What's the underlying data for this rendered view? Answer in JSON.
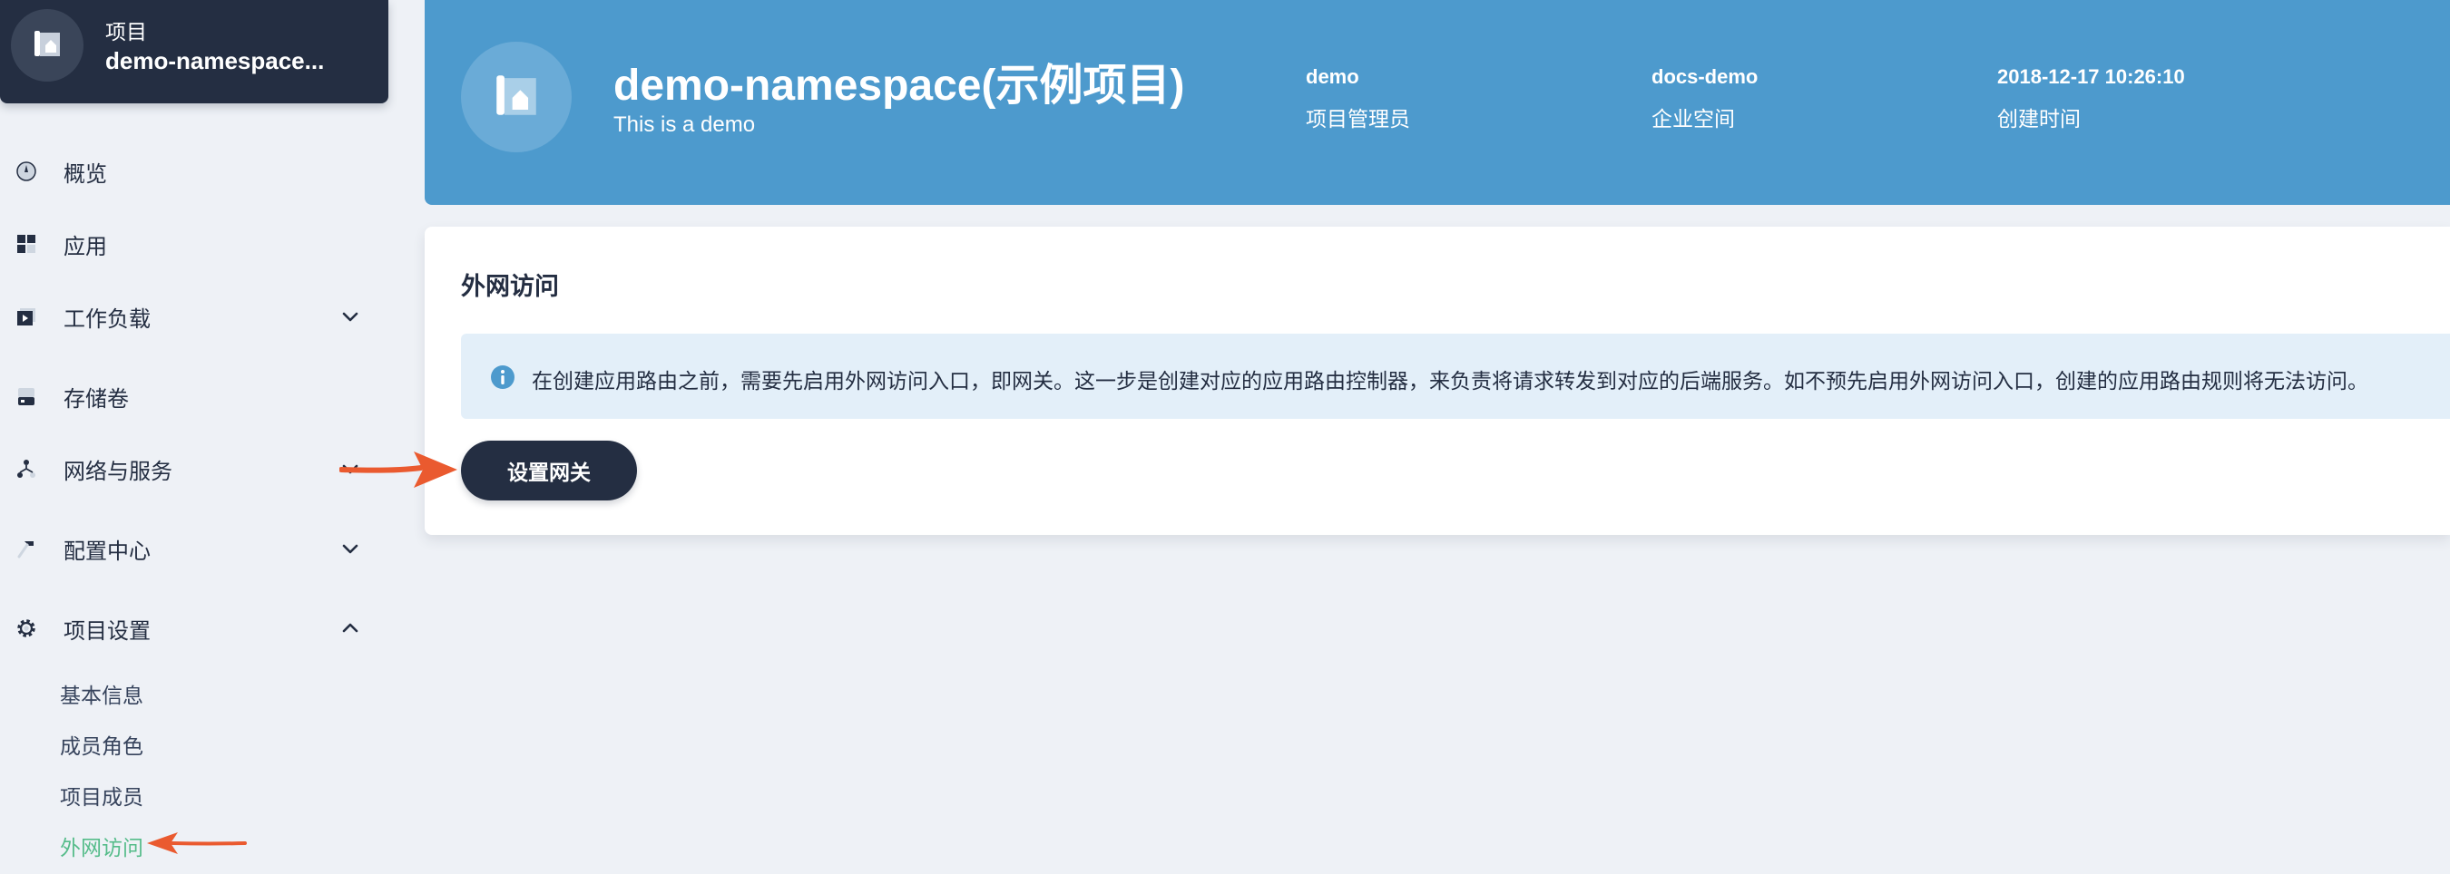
{
  "project_card": {
    "caption": "项目",
    "name": "demo-namespace..."
  },
  "sidebar": {
    "items": [
      {
        "label": "概览",
        "icon": "dashboard-icon"
      },
      {
        "label": "应用",
        "icon": "apps-icon"
      },
      {
        "label": "工作负载",
        "icon": "workload-icon",
        "expandable": true,
        "expanded": false
      },
      {
        "label": "存储卷",
        "icon": "storage-icon"
      },
      {
        "label": "网络与服务",
        "icon": "network-icon",
        "expandable": true,
        "expanded": false
      },
      {
        "label": "配置中心",
        "icon": "hammer-icon",
        "expandable": true,
        "expanded": false
      },
      {
        "label": "项目设置",
        "icon": "gear-icon",
        "expandable": true,
        "expanded": true
      }
    ],
    "sub_items": [
      {
        "label": "基本信息",
        "active": false
      },
      {
        "label": "成员角色",
        "active": false
      },
      {
        "label": "项目成员",
        "active": false
      },
      {
        "label": "外网访问",
        "active": true
      }
    ]
  },
  "banner": {
    "title": "demo-namespace(示例项目)",
    "description": "This is a demo",
    "meta": [
      {
        "value": "demo",
        "label": "项目管理员"
      },
      {
        "value": "docs-demo",
        "label": "企业空间"
      },
      {
        "value": "2018-12-17 10:26:10",
        "label": "创建时间"
      }
    ]
  },
  "main": {
    "title": "外网访问",
    "notice": "在创建应用路由之前，需要先启用外网访问入口，即网关。这一步是创建对应的应用路由控制器，来负责将请求转发到对应的后端服务。如不预先启用外网访问入口，创建的应用路由规则将无法访问。",
    "button_label": "设置网关"
  },
  "colors": {
    "banner": "#4d9acd",
    "dark": "#242e42",
    "active": "#55bc8a",
    "arrow": "#ea5a2f",
    "notice_bg": "#e3eff9"
  }
}
